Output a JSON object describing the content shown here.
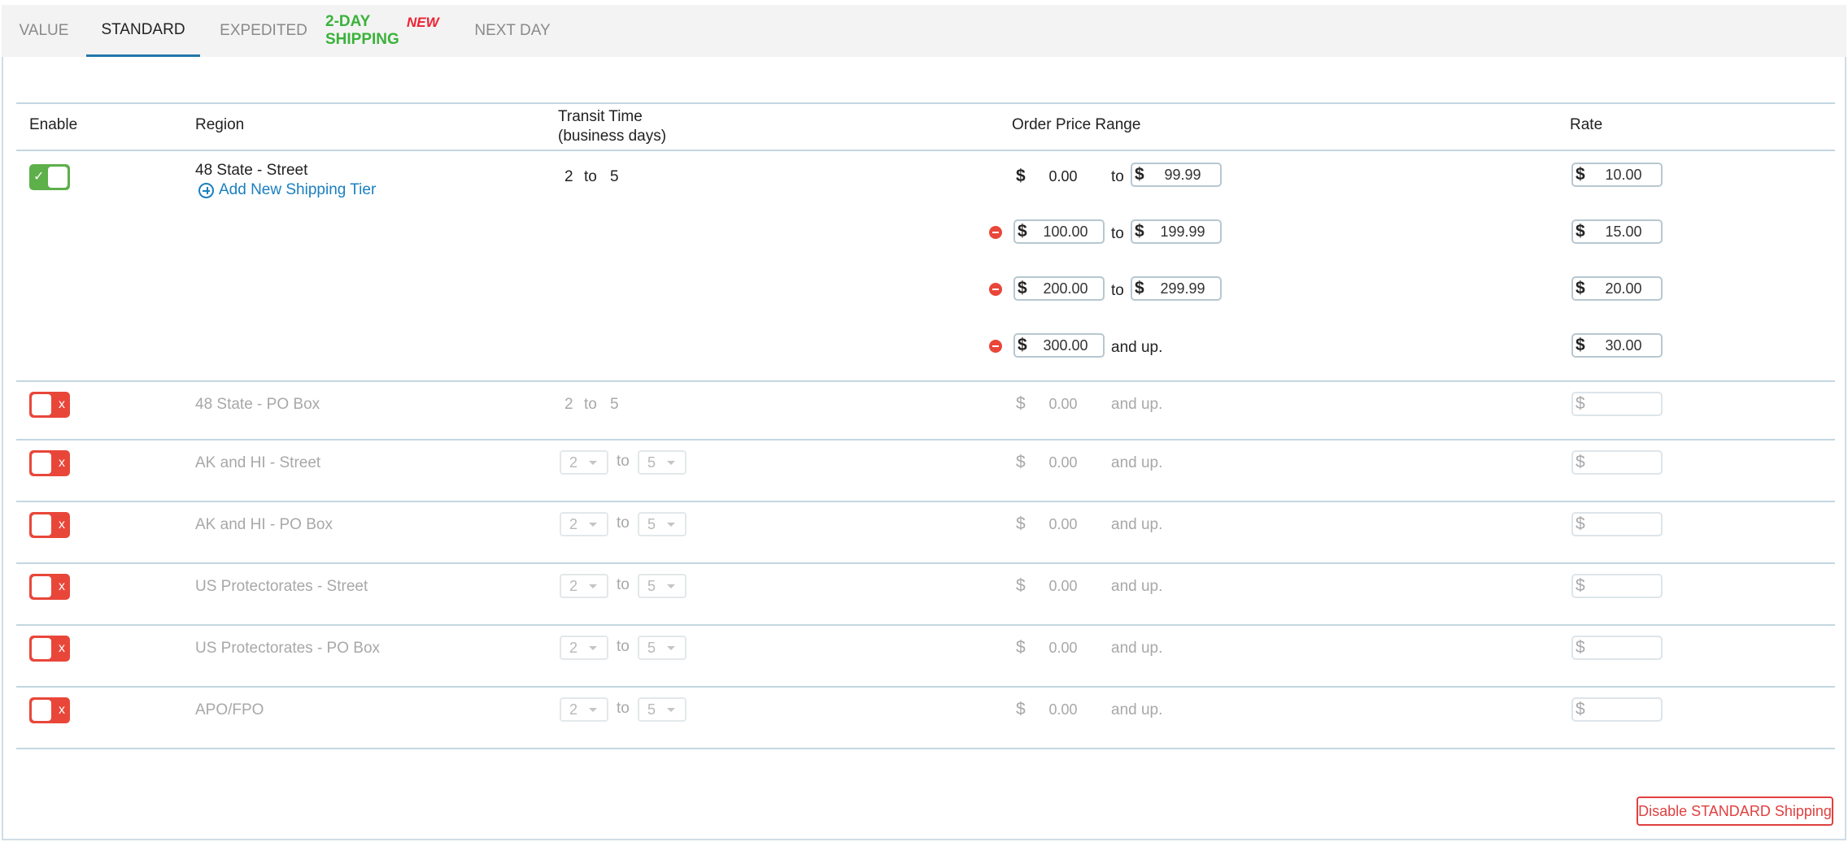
{
  "tabs": {
    "value": "VALUE",
    "standard": "STANDARD",
    "expedited": "EXPEDITED",
    "two_day": "2-DAY SHIPPING",
    "two_day_badge": "NEW",
    "next_day": "NEXT DAY"
  },
  "columns": {
    "enable": "Enable",
    "region": "Region",
    "transit_line1": "Transit Time",
    "transit_line2": "(business days)",
    "order_price": "Order Price Range",
    "rate": "Rate"
  },
  "common": {
    "currency": "$",
    "to": "to",
    "and_up": "and up.",
    "toggle_on_glyph": "✓",
    "toggle_off_glyph": "x"
  },
  "rows": [
    {
      "region": "48 State - Street",
      "enabled": true,
      "add_tier": "Add New Shipping Tier",
      "transit_min": "2",
      "transit_max": "5",
      "tiers": [
        {
          "min": "0.00",
          "max": "99.99",
          "rate": "10.00"
        },
        {
          "min": "100.00",
          "max": "199.99",
          "rate": "15.00"
        },
        {
          "min": "200.00",
          "max": "299.99",
          "rate": "20.00"
        },
        {
          "min": "300.00",
          "rate": "30.00"
        }
      ]
    },
    {
      "region": "48 State - PO Box",
      "enabled": false,
      "transit_min": "2",
      "transit_max": "5",
      "min": "0.00"
    },
    {
      "region": "AK and HI - Street",
      "enabled": false,
      "transit_min": "2",
      "transit_max": "5",
      "min": "0.00"
    },
    {
      "region": "AK and HI - PO Box",
      "enabled": false,
      "transit_min": "2",
      "transit_max": "5",
      "min": "0.00"
    },
    {
      "region": "US Protectorates - Street",
      "enabled": false,
      "transit_min": "2",
      "transit_max": "5",
      "min": "0.00"
    },
    {
      "region": "US Protectorates - PO Box",
      "enabled": false,
      "transit_min": "2",
      "transit_max": "5",
      "min": "0.00"
    },
    {
      "region": "APO/FPO",
      "enabled": false,
      "transit_min": "2",
      "transit_max": "5",
      "min": "0.00"
    }
  ],
  "footer": {
    "disable_button": "Disable STANDARD Shipping"
  },
  "colors": {
    "accent_blue": "#2277aa",
    "link_blue": "#1a7fc0",
    "toggle_on": "#5db04a",
    "toggle_off": "#e9463a",
    "new_badge": "#ee2233",
    "two_day_green": "#3ab23a"
  }
}
